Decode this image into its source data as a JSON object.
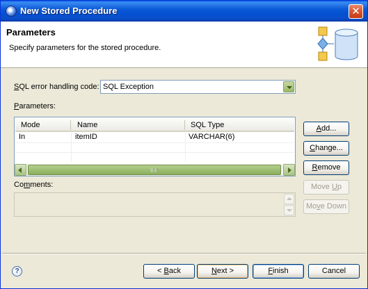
{
  "window": {
    "title": "New Stored Procedure"
  },
  "header": {
    "title": "Parameters",
    "description": "Specify parameters for the stored procedure."
  },
  "error_handling": {
    "label_prefix": "",
    "label_mnemonic": "S",
    "label_rest": "QL error handling code:",
    "selected": "SQL Exception"
  },
  "parameters": {
    "label_mnemonic": "P",
    "label_rest": "arameters:",
    "columns": [
      "Mode",
      "Name",
      "SQL Type"
    ],
    "rows": [
      {
        "mode": "In",
        "name": "itemID",
        "sql_type": "VARCHAR(6)"
      }
    ]
  },
  "side_buttons": {
    "add_mnemonic": "A",
    "add_rest": "dd...",
    "change_mnemonic": "C",
    "change_rest": "hange...",
    "remove_pre": "R",
    "remove_rest": "emove",
    "move_up_pre": "Move ",
    "move_up_mnemonic": "U",
    "move_up_rest": "p",
    "move_down_pre": "Mo",
    "move_down_mnemonic": "v",
    "move_down_rest": "e Down"
  },
  "comments": {
    "label_pre": "Co",
    "label_mnemonic": "m",
    "label_rest": "ments:",
    "value": ""
  },
  "footer": {
    "back_pre": "< ",
    "back_mnemonic": "B",
    "back_rest": "ack",
    "next_mnemonic": "N",
    "next_rest": "ext >",
    "finish_mnemonic": "F",
    "finish_rest": "inish",
    "cancel": "Cancel",
    "help": "?"
  },
  "icons": {
    "app": "eclipse-app-icon",
    "close": "close-icon",
    "header_graphic": "database-procedure-icon",
    "help": "help-icon"
  }
}
